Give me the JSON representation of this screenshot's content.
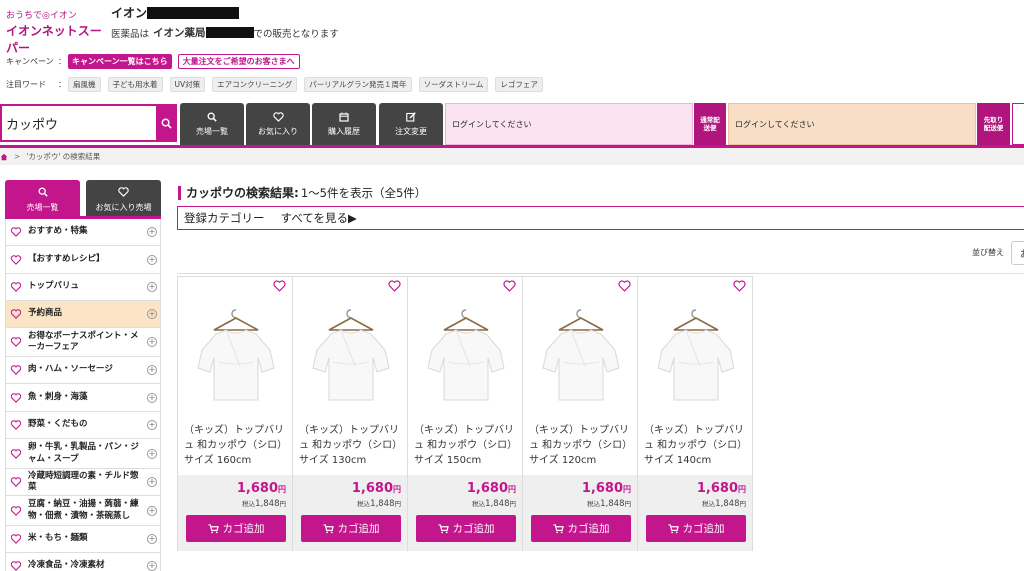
{
  "header": {
    "logo_small": "おうちで◎イオン",
    "logo_main": "イオンネットスーパー",
    "store_prefix": "イオン",
    "note_prefix": "医薬品は",
    "note_store": "イオン薬局",
    "note_suffix": "での販売となります"
  },
  "campaign": {
    "label": "キャンペーン",
    "colon": "：",
    "button_list": "キャンペーン一覧はこちら",
    "button_bulk": "大量注文をご希望のお客さまへ"
  },
  "keywords": {
    "label": "注目ワード",
    "colon": "：",
    "items": [
      "扇風機",
      "子ども用水着",
      "UV対策",
      "エアコンクリーニング",
      "パーリアルグラン発売１周年",
      "ソーダストリーム",
      "レゴフェア"
    ]
  },
  "navbar": {
    "search_value": "カッポウ",
    "buttons": [
      "売場一覧",
      "お気に入り",
      "購入履歴",
      "注文変更"
    ],
    "login_text_1": "ログインしてください",
    "delivery_normal": "通常配\n送便",
    "login_text_2": "ログインしてください",
    "delivery_pickup": "先取り\n配送便"
  },
  "breadcrumb": {
    "separator": ">",
    "current": "'カッポウ' の検索結果"
  },
  "sidebar": {
    "tab_active": "売場一覧",
    "tab_inactive": "お気に入り売場",
    "items": [
      {
        "label": "おすすめ・特集",
        "highlight": false
      },
      {
        "label": "【おすすめレシピ】",
        "highlight": false
      },
      {
        "label": "トップバリュ",
        "highlight": false
      },
      {
        "label": "予約商品",
        "highlight": true
      },
      {
        "label": "お得なボーナスポイント・メーカーフェア",
        "highlight": false
      },
      {
        "label": "肉・ハム・ソーセージ",
        "highlight": false
      },
      {
        "label": "魚・刺身・海藻",
        "highlight": false
      },
      {
        "label": "野菜・くだもの",
        "highlight": false
      },
      {
        "label": "卵・牛乳・乳製品・パン・ジャム・スープ",
        "highlight": false
      },
      {
        "label": "冷蔵時短調理の素・チルド惣菜",
        "highlight": false
      },
      {
        "label": "豆腐・納豆・油揚・蒟蒻・練物・佃煮・漬物・茶碗蒸し",
        "highlight": false
      },
      {
        "label": "米・もち・麺類",
        "highlight": false
      },
      {
        "label": "冷凍食品・冷凍素材",
        "highlight": false
      }
    ]
  },
  "results": {
    "title": "カッポウの検索結果:",
    "count": "1～5件を表示（全5件）",
    "category_label": "登録カテゴリー",
    "category_link": "すべてを見る▶",
    "sort_label": "並び替え",
    "sort_value": "お"
  },
  "products": [
    {
      "name": "（キッズ）トップバリュ 和カッポウ（シロ）サイズ 160cm",
      "price": "1,680",
      "tax_label": "税込",
      "tax_price": "1,848",
      "yen": "円",
      "cart": "カゴ追加"
    },
    {
      "name": "（キッズ）トップバリュ 和カッポウ（シロ）サイズ 130cm",
      "price": "1,680",
      "tax_label": "税込",
      "tax_price": "1,848",
      "yen": "円",
      "cart": "カゴ追加"
    },
    {
      "name": "（キッズ）トップバリュ 和カッポウ（シロ）サイズ 150cm",
      "price": "1,680",
      "tax_label": "税込",
      "tax_price": "1,848",
      "yen": "円",
      "cart": "カゴ追加"
    },
    {
      "name": "（キッズ）トップバリュ 和カッポウ（シロ）サイズ 120cm",
      "price": "1,680",
      "tax_label": "税込",
      "tax_price": "1,848",
      "yen": "円",
      "cart": "カゴ追加"
    },
    {
      "name": "（キッズ）トップバリュ 和カッポウ（シロ）サイズ 140cm",
      "price": "1,680",
      "tax_label": "税込",
      "tax_price": "1,848",
      "yen": "円",
      "cart": "カゴ追加"
    }
  ],
  "colors": {
    "brand": "#c3158c",
    "dark_nav": "#444444",
    "login_pink": "#fbe3f1",
    "login_peach": "#f9dec6",
    "highlight": "#fce4c6"
  }
}
